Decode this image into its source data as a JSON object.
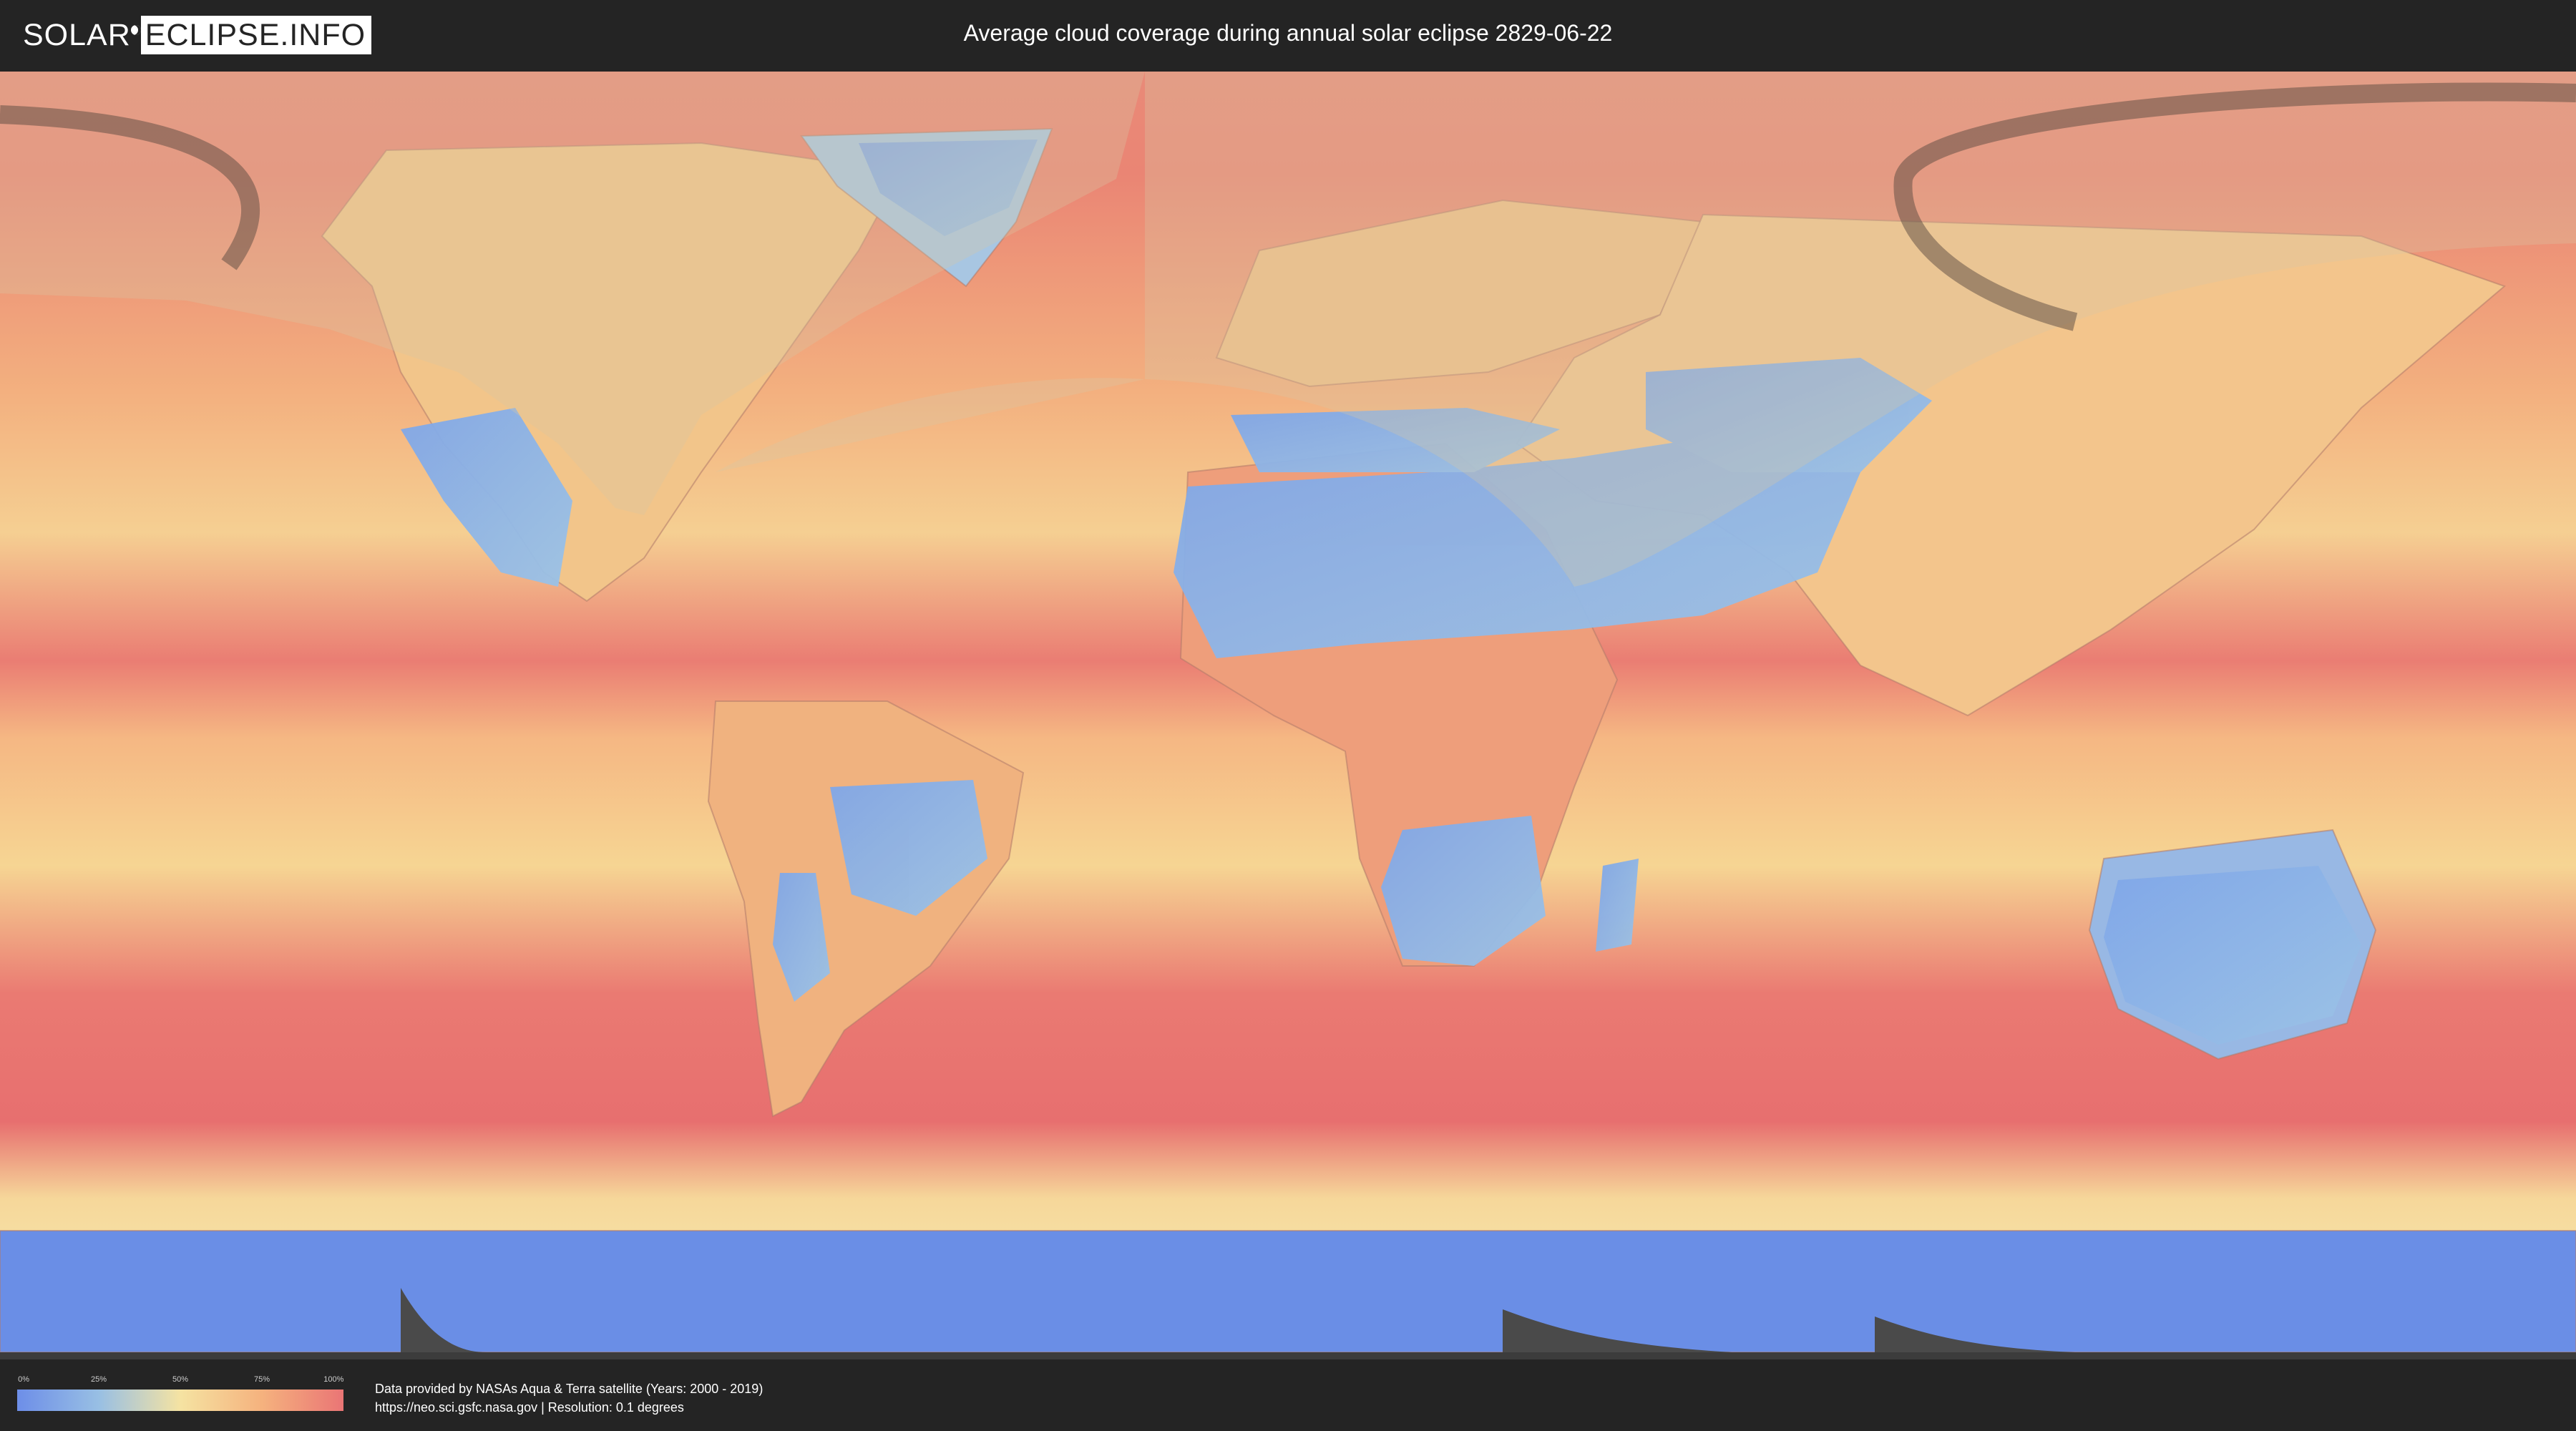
{
  "header": {
    "logo_part1": "SOLAR",
    "logo_part2": "ECLIPSE.INFO",
    "title": "Average cloud coverage during annual solar eclipse 2829-06-22"
  },
  "map": {
    "projection": "equirectangular",
    "overlay": "eclipse visibility zone and annular path shading",
    "colors": {
      "ocean_cloudy": "#ea7a74",
      "mid_cloud": "#f5b27e",
      "low_cloud": "#f5e3a2",
      "clear": "#8fb4e6",
      "antarctica": "#5a80e3",
      "background": "#3c3c3c"
    }
  },
  "legend": {
    "ticks": [
      "0%",
      "25%",
      "50%",
      "75%",
      "100%"
    ]
  },
  "footer": {
    "credit_line1": "Data provided by NASAs Aqua & Terra satellite (Years: 2000 - 2019)",
    "credit_line2": "https://neo.sci.gsfc.nasa.gov | Resolution: 0.1 degrees"
  }
}
